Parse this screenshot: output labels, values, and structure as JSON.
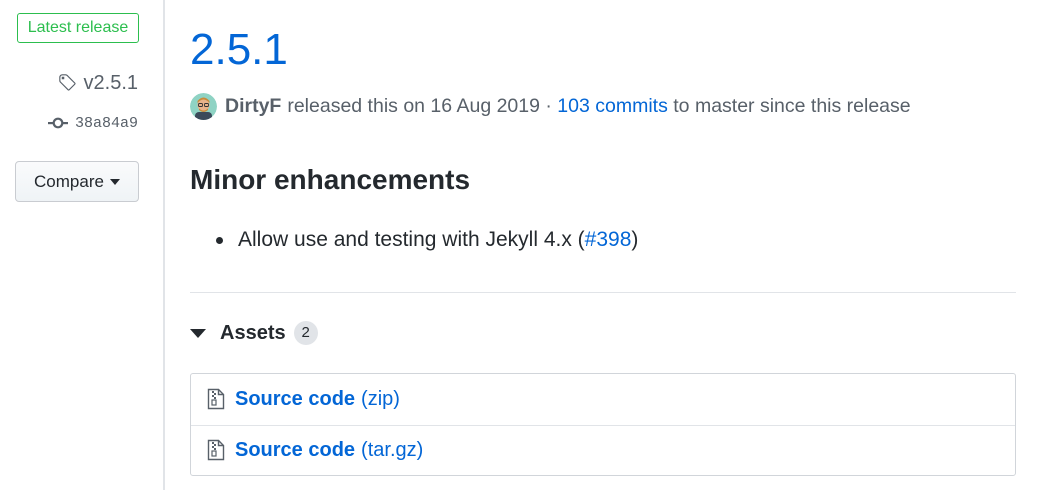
{
  "sidebar": {
    "latest_label": "Latest release",
    "tag": "v2.5.1",
    "commit": "38a84a9",
    "compare_label": "Compare"
  },
  "release": {
    "title": "2.5.1",
    "author": "DirtyF",
    "released_text": "released this on 16 Aug 2019 ·",
    "commits_link": "103 commits",
    "commits_suffix": "to master since this release"
  },
  "notes": {
    "heading": "Minor enhancements",
    "items": [
      {
        "text": "Allow use and testing with Jekyll 4.x (",
        "link": "#398",
        "suffix": ")"
      }
    ]
  },
  "assets": {
    "label": "Assets",
    "count": "2",
    "items": [
      {
        "name": "Source code",
        "type": "(zip)",
        "icon": "file-zip-icon"
      },
      {
        "name": "Source code",
        "type": "(tar.gz)",
        "icon": "file-zip-icon"
      }
    ]
  },
  "colors": {
    "link": "#0366d6",
    "latest_green": "#2cbe4e",
    "muted": "#586069"
  }
}
